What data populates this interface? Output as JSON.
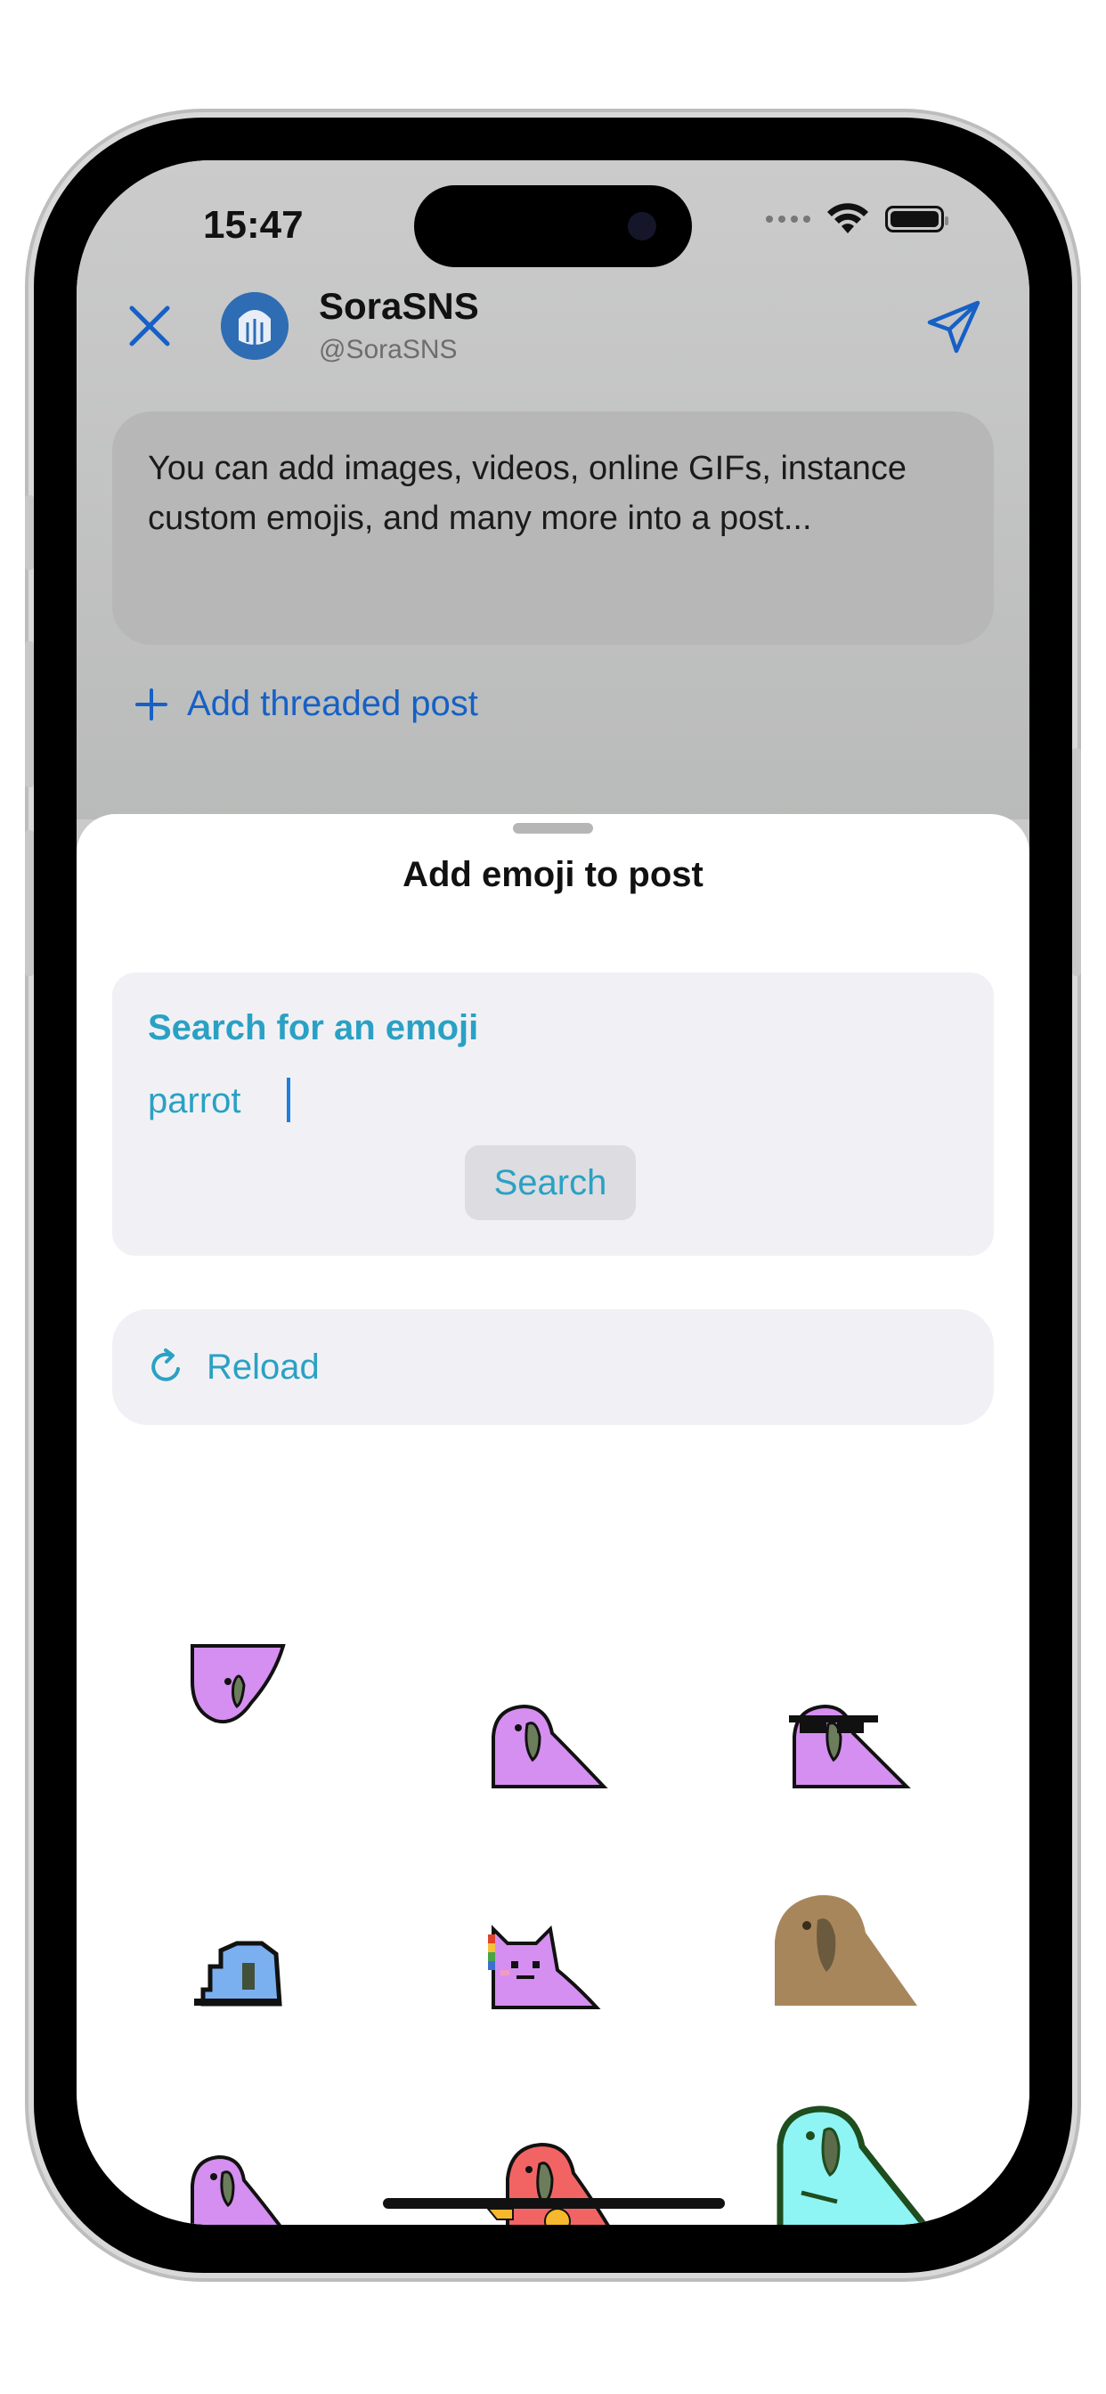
{
  "status_bar": {
    "time": "15:47"
  },
  "compose": {
    "account_name": "SoraSNS",
    "account_handle": "@SoraSNS",
    "post_text": "You can add images, videos, online GIFs, instance custom emojis, and many more into a post...",
    "add_thread_label": "Add threaded post"
  },
  "sheet": {
    "title": "Add emoji to post",
    "search_label": "Search for an emoji",
    "search_value": "parrot",
    "search_button": "Search",
    "reload_label": "Reload"
  },
  "colors": {
    "accent": "#2aa1c4",
    "link_blue": "#1660c6",
    "card_bg": "#f1f1f5"
  },
  "icons": [
    "close-icon",
    "send-icon",
    "plus-icon",
    "reload-icon"
  ]
}
